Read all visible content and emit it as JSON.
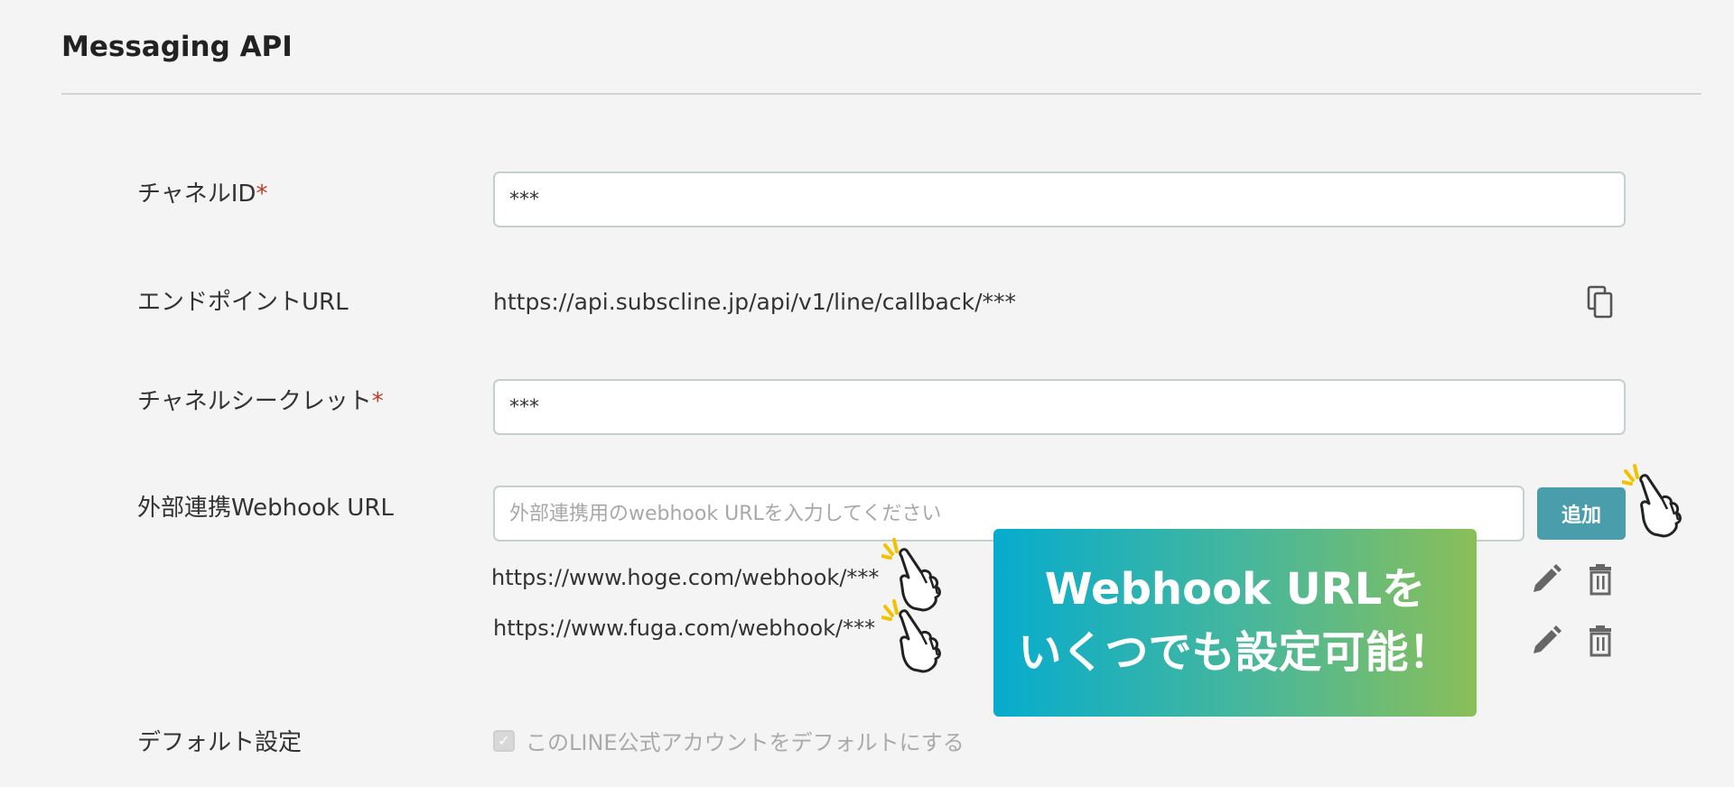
{
  "section": {
    "title": "Messaging API"
  },
  "form": {
    "channel_id": {
      "label": "チャネルID",
      "required_mark": "*",
      "value": "***"
    },
    "endpoint_url": {
      "label": "エンドポイントURL",
      "value": "https://api.subscline.jp/api/v1/line/callback/***"
    },
    "channel_secret": {
      "label": "チャネルシークレット",
      "required_mark": "*",
      "value": "***"
    },
    "webhook": {
      "label": "外部連携Webhook URL",
      "placeholder": "外部連携用のwebhook URLを入力してください",
      "add_label": "追加",
      "items": [
        {
          "url": "https://www.hoge.com/webhook/***"
        },
        {
          "url": "https://www.fuga.com/webhook/***"
        }
      ]
    },
    "default_setting": {
      "label": "デフォルト設定",
      "checkbox_label": "このLINE公式アカウントをデフォルトにする",
      "checked": true
    }
  },
  "callout": {
    "line1": "Webhook URLを",
    "line2": "いくつでも設定可能！"
  },
  "icons": {
    "copy": "copy-icon",
    "edit": "pencil-icon",
    "delete": "trash-icon",
    "pointer": "pointing-hand-icon",
    "check": "checkmark-icon"
  },
  "colors": {
    "accent": "#4a9dab",
    "required": "#c0392b",
    "callout_start": "#06acce",
    "callout_end": "#8abf58"
  }
}
